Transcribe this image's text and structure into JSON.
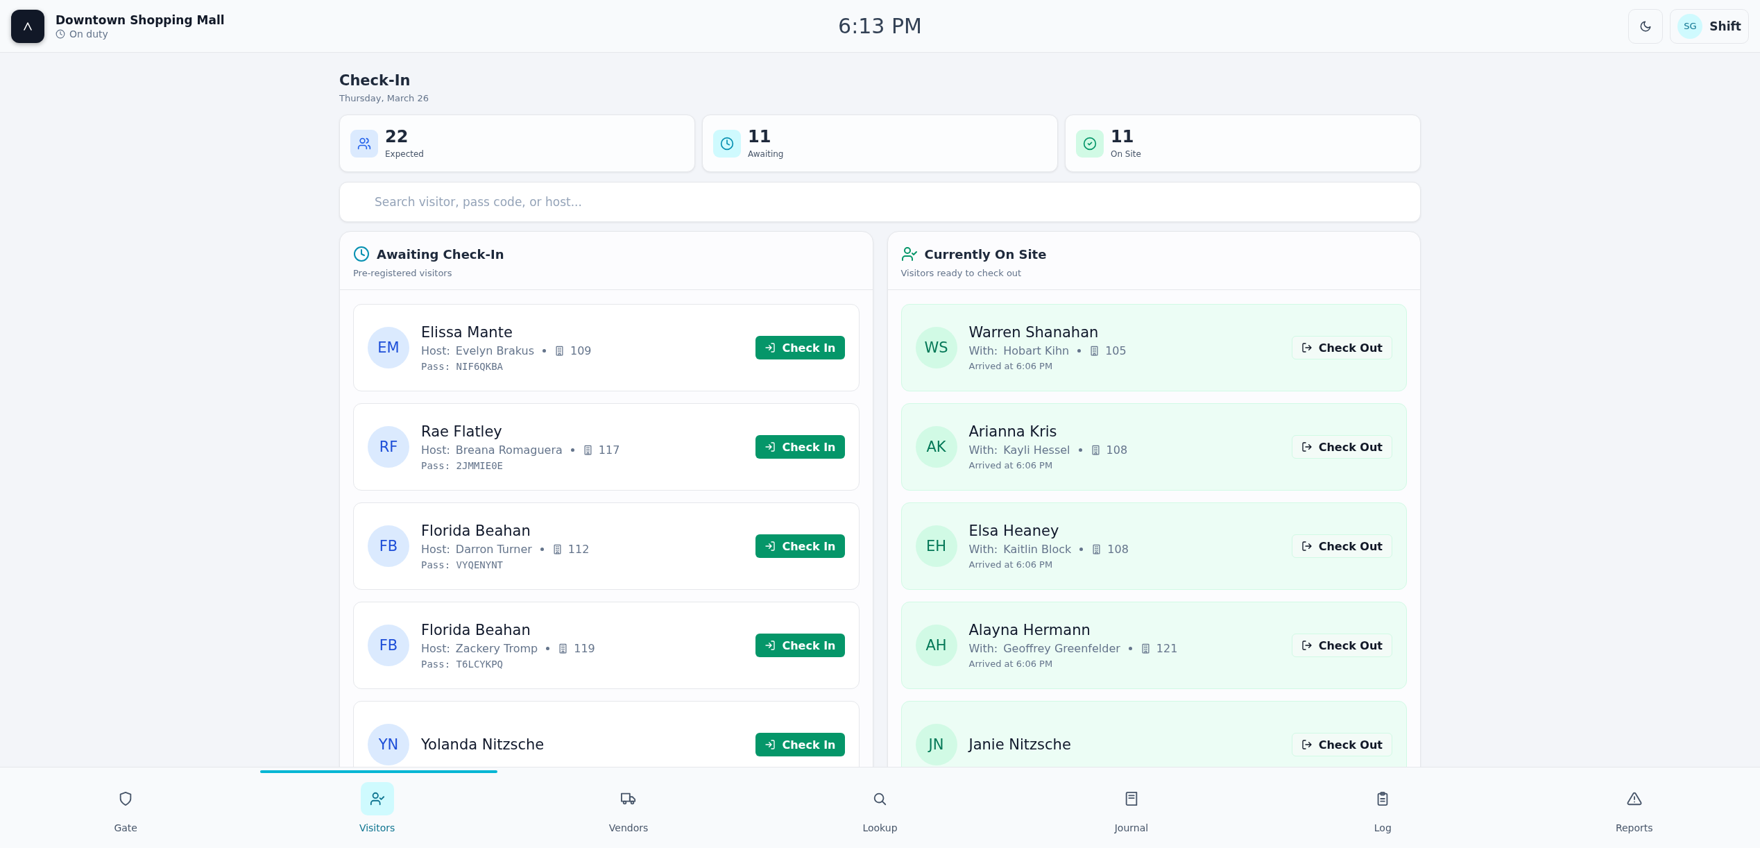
{
  "header": {
    "title": "Downtown Shopping Mall",
    "status": "On duty",
    "time": "6:13 PM",
    "user_initials": "SG",
    "user_button": "Shift"
  },
  "page": {
    "title": "Check-In",
    "date": "Thursday, March 26"
  },
  "stats": [
    {
      "kind": "expected",
      "value": "22",
      "label": "Expected"
    },
    {
      "kind": "awaiting",
      "value": "11",
      "label": "Awaiting"
    },
    {
      "kind": "onsite",
      "value": "11",
      "label": "On Site"
    }
  ],
  "search": {
    "placeholder": "Search visitor, pass code, or host..."
  },
  "panels": [
    {
      "kind": "awaiting",
      "title": "Awaiting Check-In",
      "subtitle": "Pre-registered visitors",
      "visitors": [
        {
          "initials": "EM",
          "name": "Elissa Mante",
          "host_label": "Host:",
          "host": "Evelyn Brakus",
          "room": "109",
          "pass_label": "Pass:",
          "pass": "NIF6QKBA",
          "action": "Check In"
        },
        {
          "initials": "RF",
          "name": "Rae Flatley",
          "host_label": "Host:",
          "host": "Breana Romaguera",
          "room": "117",
          "pass_label": "Pass:",
          "pass": "2JMMIE0E",
          "action": "Check In"
        },
        {
          "initials": "FB",
          "name": "Florida Beahan",
          "host_label": "Host:",
          "host": "Darron Turner",
          "room": "112",
          "pass_label": "Pass:",
          "pass": "VYQENYNT",
          "action": "Check In"
        },
        {
          "initials": "FB",
          "name": "Florida Beahan",
          "host_label": "Host:",
          "host": "Zackery Tromp",
          "room": "119",
          "pass_label": "Pass:",
          "pass": "T6LCYKPQ",
          "action": "Check In"
        },
        {
          "initials": "YN",
          "name": "Yolanda Nitzsche",
          "action": "Check In"
        }
      ]
    },
    {
      "kind": "onsite",
      "title": "Currently On Site",
      "subtitle": "Visitors ready to check out",
      "visitors": [
        {
          "initials": "WS",
          "name": "Warren Shanahan",
          "host_label": "With:",
          "host": "Hobart Kihn",
          "room": "105",
          "arrived": "Arrived at 6:06 PM",
          "action": "Check Out"
        },
        {
          "initials": "AK",
          "name": "Arianna Kris",
          "host_label": "With:",
          "host": "Kayli Hessel",
          "room": "108",
          "arrived": "Arrived at 6:06 PM",
          "action": "Check Out"
        },
        {
          "initials": "EH",
          "name": "Elsa Heaney",
          "host_label": "With:",
          "host": "Kaitlin Block",
          "room": "108",
          "arrived": "Arrived at 6:06 PM",
          "action": "Check Out"
        },
        {
          "initials": "AH",
          "name": "Alayna Hermann",
          "host_label": "With:",
          "host": "Geoffrey Greenfelder",
          "room": "121",
          "arrived": "Arrived at 6:06 PM",
          "action": "Check Out"
        },
        {
          "initials": "JN",
          "name": "Janie Nitzsche",
          "action": "Check Out"
        }
      ]
    }
  ],
  "nav": [
    {
      "kind": "gate",
      "label": "Gate",
      "selected": false
    },
    {
      "kind": "visitors",
      "label": "Visitors",
      "selected": true
    },
    {
      "kind": "vendors",
      "label": "Vendors",
      "selected": false
    },
    {
      "kind": "lookup",
      "label": "Lookup",
      "selected": false
    },
    {
      "kind": "journal",
      "label": "Journal",
      "selected": false
    },
    {
      "kind": "log",
      "label": "Log",
      "selected": false
    },
    {
      "kind": "reports",
      "label": "Reports",
      "selected": false
    }
  ]
}
